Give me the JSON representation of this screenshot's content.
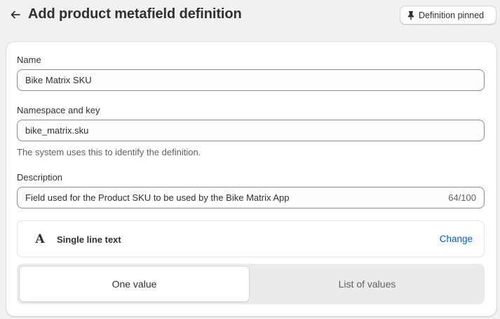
{
  "header": {
    "title": "Add product metafield definition",
    "pin_button_label": "Definition pinned"
  },
  "form": {
    "name": {
      "label": "Name",
      "value": "Bike Matrix SKU"
    },
    "namespace_key": {
      "label": "Namespace and key",
      "value": "bike_matrix.sku",
      "help_text": "The system uses this to identify the definition."
    },
    "description": {
      "label": "Description",
      "value": "Field used for the Product SKU to be used by the Bike Matrix App",
      "char_count": "64/100"
    },
    "type": {
      "icon": "text-type-icon",
      "icon_glyph": "A",
      "name": "Single line text",
      "change_label": "Change"
    },
    "value_mode": {
      "options": [
        "One value",
        "List of values"
      ],
      "selected": "One value"
    }
  },
  "colors": {
    "link": "#005bd3",
    "background": "#f1f1f1"
  }
}
